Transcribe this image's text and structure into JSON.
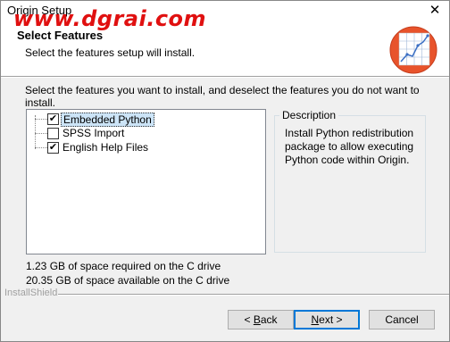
{
  "window": {
    "title": "Origin Setup",
    "close_glyph": "✕",
    "watermark": "www.dgrai.com"
  },
  "header": {
    "title": "Select Features",
    "subtitle": "Select the features setup will install."
  },
  "main": {
    "instruction": "Select the features you want to install, and deselect the features you do not want to install.",
    "features": [
      {
        "label": "Embedded Python",
        "checked": true,
        "selected": true
      },
      {
        "label": "SPSS Import",
        "checked": false,
        "selected": false
      },
      {
        "label": "English Help Files",
        "checked": true,
        "selected": false
      }
    ],
    "description": {
      "title": "Description",
      "text": "Install Python redistribution package to allow executing Python code within Origin."
    },
    "space_required": "1.23 GB of space required on the C drive",
    "space_available": "20.35 GB of space available on the C drive"
  },
  "footer": {
    "brand": "InstallShield",
    "back_prefix": "< ",
    "back_key": "B",
    "back_rest": "ack",
    "next_key": "N",
    "next_rest": "ext >",
    "cancel_label": "Cancel"
  },
  "icons": {
    "logo": "origin-logo-icon",
    "check": "checkmark-icon"
  },
  "colors": {
    "watermark": "#e01010",
    "logo": "#e8532b",
    "default_button_border": "#0078d7"
  }
}
